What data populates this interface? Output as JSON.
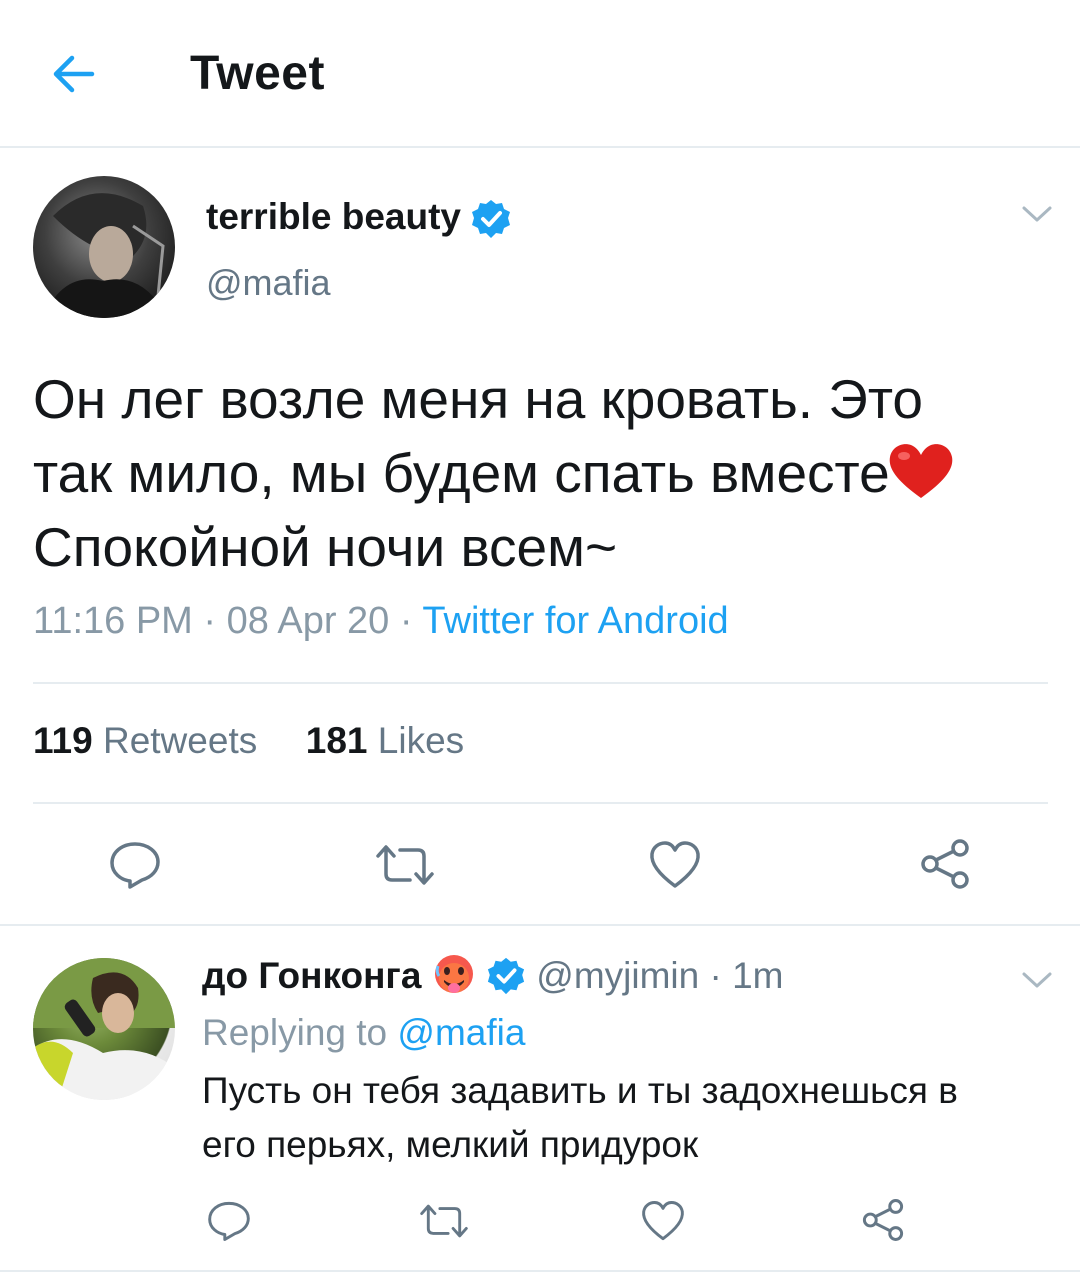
{
  "header": {
    "title": "Tweet",
    "back_icon": "arrow-left-icon"
  },
  "tweet": {
    "author_name": "terrible beauty",
    "author_handle": "@mafia",
    "verified_icon": "verified-badge-icon",
    "text_line1": "Он лег возле меня на кровать. Это",
    "text_line2": "так мило, мы будем спать вместе",
    "text_line3": "Спокойной ночи всем~",
    "emoji": "heart-emoji",
    "time": "11:16 PM",
    "date": "08 Apr 20",
    "source": "Twitter for Android",
    "dot": "·",
    "retweets_count": "119",
    "retweets_label": "Retweets",
    "likes_count": "181",
    "likes_label": "Likes"
  },
  "actions": {
    "reply_icon": "reply-icon",
    "retweet_icon": "retweet-icon",
    "like_icon": "heart-outline-icon",
    "share_icon": "share-icon"
  },
  "reply": {
    "author_name": "до Гонконга",
    "emoji": "hot-face-emoji",
    "author_handle": "@myjimin",
    "dot": "·",
    "time": "1m",
    "replying_to_label": "Replying to",
    "replying_to_handle": "@mafia",
    "text_line1": "Пусть он тебя задавить и ты задохнешься в",
    "text_line2": "его перьях, мелкий придурок"
  },
  "colors": {
    "accent": "#1da1f2",
    "text": "#14171a",
    "secondary": "#657786",
    "border": "#e6ecf0",
    "action_icon": "#657786"
  }
}
